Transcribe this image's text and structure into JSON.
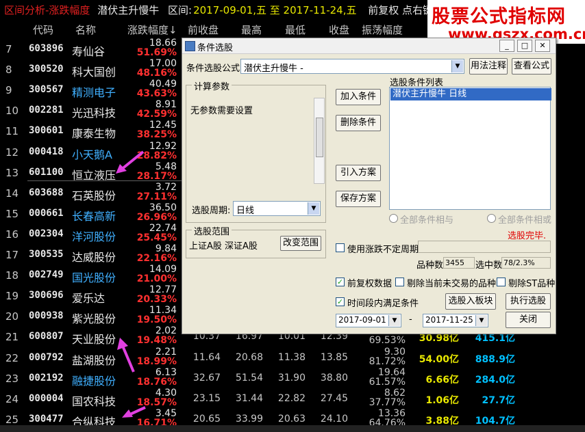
{
  "topbar": {
    "title": "区间分析-涨跌幅度",
    "formula": "潜伏主升慢牛",
    "range_label": "区间:",
    "range_value": "2017-09-01,五 至 2017-11-24,五",
    "adjust": "前复权 点右键操作"
  },
  "brand": {
    "line1": "股票公式指标网",
    "line2": "www.gszx.com.cn"
  },
  "columns": [
    "代码",
    "名称",
    "涨跌幅度↓",
    "前收盘",
    "最高",
    "最低",
    "收盘",
    "振荡幅度"
  ],
  "rows": [
    {
      "idx": "7",
      "code": "603896",
      "name": "寿仙谷",
      "name_color": "#e8e8e8",
      "v1": "18.66",
      "chg": "51.69%"
    },
    {
      "idx": "8",
      "code": "300520",
      "name": "科大国创",
      "name_color": "#e8e8e8",
      "v1": "17.00",
      "chg": "48.16%"
    },
    {
      "idx": "9",
      "code": "300567",
      "name": "精测电子",
      "name_color": "#40b0ff",
      "v1": "40.49",
      "chg": "43.63%"
    },
    {
      "idx": "10",
      "code": "002281",
      "name": "光迅科技",
      "name_color": "#e8e8e8",
      "v1": "8.91",
      "chg": "42.59%"
    },
    {
      "idx": "11",
      "code": "300601",
      "name": "康泰生物",
      "name_color": "#e8e8e8",
      "v1": "12.45",
      "chg": "38.25%"
    },
    {
      "idx": "12",
      "code": "000418",
      "name": "小天鹅A",
      "name_color": "#40b0ff",
      "v1": "12.92",
      "chg": "28.82%"
    },
    {
      "idx": "13",
      "code": "601100",
      "name": "恒立液压",
      "name_color": "#e8e8e8",
      "v1": "5.48",
      "chg": "28.17%"
    },
    {
      "idx": "14",
      "code": "603688",
      "name": "石英股份",
      "name_color": "#e8e8e8",
      "v1": "3.72",
      "chg": "27.11%"
    },
    {
      "idx": "15",
      "code": "000661",
      "name": "长春高新",
      "name_color": "#40b0ff",
      "v1": "36.50",
      "chg": "26.96%"
    },
    {
      "idx": "16",
      "code": "002304",
      "name": "洋河股份",
      "name_color": "#40b0ff",
      "v1": "22.74",
      "chg": "25.45%"
    },
    {
      "idx": "17",
      "code": "300535",
      "name": "达威股份",
      "name_color": "#e8e8e8",
      "v1": "9.84",
      "chg": "22.16%"
    },
    {
      "idx": "18",
      "code": "002749",
      "name": "国光股份",
      "name_color": "#40b0ff",
      "v1": "14.09",
      "chg": "21.00%"
    },
    {
      "idx": "19",
      "code": "300696",
      "name": "爱乐达",
      "name_color": "#e8e8e8",
      "v1": "12.77",
      "chg": "20.33%"
    },
    {
      "idx": "20",
      "code": "000938",
      "name": "紫光股份",
      "name_color": "#e8e8e8",
      "v1": "11.34",
      "chg": "19.50%"
    },
    {
      "idx": "21",
      "code": "600807",
      "name": "天业股份",
      "name_color": "#e8e8e8",
      "v1": "2.02",
      "chg": "19.48%",
      "prev": "10.37",
      "high": "16.97",
      "low": "10.01",
      "close": "12.39",
      "amp1": "",
      "amp2": "69.53%",
      "amt": "30.98亿",
      "mkt": "415.1亿"
    },
    {
      "idx": "22",
      "code": "000792",
      "name": "盐湖股份",
      "name_color": "#e8e8e8",
      "v1": "2.21",
      "chg": "18.99%",
      "prev": "11.64",
      "high": "20.68",
      "low": "11.38",
      "close": "13.85",
      "amp1": "9.30",
      "amp2": "81.72%",
      "amt": "54.00亿",
      "mkt": "888.9亿"
    },
    {
      "idx": "23",
      "code": "002192",
      "name": "融捷股份",
      "name_color": "#40b0ff",
      "v1": "6.13",
      "chg": "18.76%",
      "prev": "32.67",
      "high": "51.54",
      "low": "31.90",
      "close": "38.80",
      "amp1": "19.64",
      "amp2": "61.57%",
      "amt": "6.66亿",
      "mkt": "284.0亿"
    },
    {
      "idx": "24",
      "code": "000004",
      "name": "国农科技",
      "name_color": "#e8e8e8",
      "v1": "4.30",
      "chg": "18.57%",
      "prev": "23.15",
      "high": "31.44",
      "low": "22.82",
      "close": "27.45",
      "amp1": "8.62",
      "amp2": "37.77%",
      "amt": "1.06亿",
      "mkt": "27.7亿"
    },
    {
      "idx": "25",
      "code": "300477",
      "name": "合纵科技",
      "name_color": "#e8e8e8",
      "v1": "3.45",
      "chg": "16.71%",
      "prev": "20.65",
      "high": "33.99",
      "low": "20.63",
      "close": "24.10",
      "amp1": "13.36",
      "amp2": "64.76%",
      "amt": "3.88亿",
      "mkt": "104.7亿"
    }
  ],
  "dialog": {
    "title": "条件选股",
    "formula_label": "条件选股公式",
    "formula_value": "潜伏主升慢牛 -",
    "usage_button": "用法注释",
    "view_formula_button": "查看公式",
    "params_group": "计算参数",
    "params_text": "无参数需要设置",
    "period_label": "选股周期:",
    "period_value": "日线",
    "add_button": "加入条件",
    "delete_button": "删除条件",
    "import_button": "引入方案",
    "save_button": "保存方案",
    "list_label": "选股条件列表",
    "list_item": "潜伏主升慢牛   日线",
    "radio_and": "全部条件相与",
    "radio_or": "全部条件相或",
    "done_text": "选股完毕.",
    "scope_group": "选股范围",
    "scope_text": "上证A股 深证A股",
    "scope_button": "改变范围",
    "use_period_label": "使用涨跌不定周期",
    "count_label": "品种数",
    "count_value": "3455",
    "selected_label": "选中数",
    "selected_value": "78/2.3%",
    "adj_label": "前复权数据",
    "exclude_label": "剔除当前未交易的品种",
    "exclude_st_label": "剔除ST品种",
    "period_ok_label": "时间段内满足条件",
    "to_block_button": "选股入板块",
    "run_button": "执行选股",
    "date_from": "2017-09-01",
    "date_dash": "-",
    "date_to": "2017-11-25",
    "close_button": "关闭"
  }
}
